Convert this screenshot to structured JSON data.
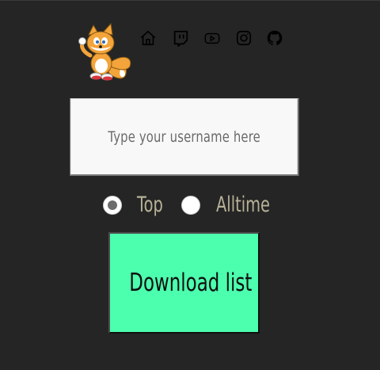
{
  "header": {
    "mascot": "fox-mascot-logo",
    "links": [
      {
        "icon": "home-icon"
      },
      {
        "icon": "twitch-icon"
      },
      {
        "icon": "youtube-icon"
      },
      {
        "icon": "instagram-icon"
      },
      {
        "icon": "github-icon"
      }
    ]
  },
  "form": {
    "username": {
      "placeholder": "Type your username here",
      "value": ""
    },
    "mode": {
      "options": [
        {
          "label": "Top",
          "checked": true
        },
        {
          "label": "Alltime",
          "checked": false
        }
      ]
    },
    "download_label": "Download list"
  },
  "colors": {
    "background": "#252525",
    "button": "#4cffae",
    "radio_label": "#b7b197",
    "input_bg": "#f8f8f8"
  }
}
